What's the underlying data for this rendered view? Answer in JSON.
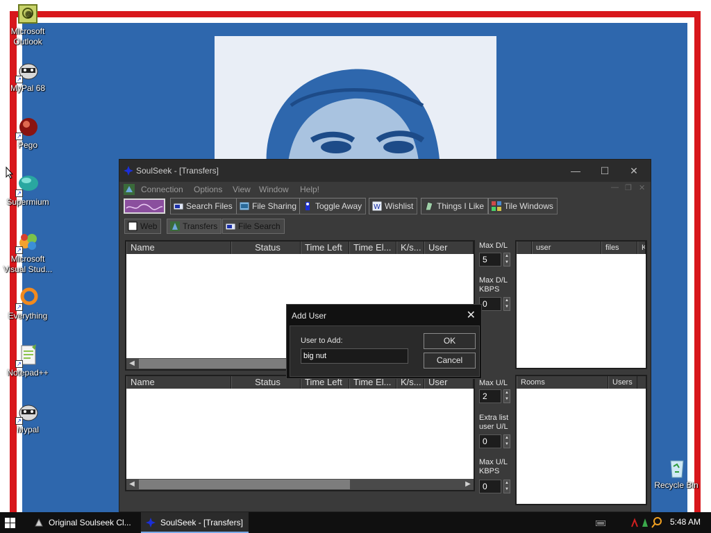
{
  "desktop": {
    "icons": [
      {
        "label": "Microsoft\nOutlook",
        "icon": "outlook-icon"
      },
      {
        "label": "MyPal 68",
        "icon": "raccoon-icon"
      },
      {
        "label": "Pego",
        "icon": "pego-icon"
      },
      {
        "label": "Supermium",
        "icon": "supermium-icon"
      },
      {
        "label": "Microsoft\nVisual Stud...",
        "icon": "visual-studio-icon"
      },
      {
        "label": "Everything",
        "icon": "everything-icon"
      },
      {
        "label": "Notepad++",
        "icon": "notepadpp-icon"
      },
      {
        "label": "Mypal",
        "icon": "raccoon-icon"
      }
    ],
    "recycle_bin": {
      "label": "Recycle Bin",
      "icon": "recycle-bin-icon"
    },
    "colors": {
      "frame_red": "#d8171c",
      "wall_blue": "#2e67ad",
      "poster_light": "#a9c3e0",
      "poster_dark": "#2e67ad"
    }
  },
  "window": {
    "title": "SoulSeek - [Transfers]",
    "controls": {
      "minimize": "—",
      "maximize": "☐",
      "close": "✕"
    },
    "menu": [
      "Connection",
      "Options",
      "View",
      "Window",
      "Help!"
    ],
    "toolbar": [
      {
        "label": "Search Files",
        "icon": "search-files-icon"
      },
      {
        "label": "File Sharing",
        "icon": "file-sharing-icon"
      },
      {
        "label": "Toggle Away",
        "icon": "toggle-away-icon"
      },
      {
        "label": "Wishlist",
        "icon": "wishlist-icon"
      },
      {
        "label": "Things I Like",
        "icon": "things-i-like-icon"
      },
      {
        "label": "Tile Windows",
        "icon": "tile-windows-icon"
      }
    ],
    "tabs": [
      {
        "label": "Web",
        "icon": "web-icon"
      },
      {
        "label": "Transfers",
        "icon": "transfers-icon"
      },
      {
        "label": "File Search",
        "icon": "file-search-icon"
      }
    ],
    "downloads": {
      "columns": [
        "Name",
        "Status",
        "Time Left",
        "Time El...",
        "K/s...",
        "User"
      ],
      "rows": []
    },
    "uploads": {
      "columns": [
        "Name",
        "Status",
        "Time Left",
        "Time El...",
        "K/s...",
        "User"
      ],
      "rows": []
    },
    "download_settings": {
      "max_dl_label": "Max D/L",
      "max_dl_value": "5",
      "max_dl_kbps_label": "Max D/L\nKBPS",
      "max_dl_kbps_value": "0"
    },
    "upload_settings": {
      "max_ul_label": "Max U/L",
      "max_ul_value": "2",
      "extra_list_label": "Extra list\nuser U/L",
      "extra_list_value": "0",
      "max_ul_kbps_label": "Max U/L\nKBPS",
      "max_ul_kbps_value": "0"
    },
    "users_list": {
      "columns": [
        "",
        "user",
        "files",
        "K"
      ]
    },
    "rooms_list": {
      "columns": [
        "Rooms",
        "Users"
      ]
    }
  },
  "dialog": {
    "title": "Add User",
    "close": "✕",
    "label": "User to Add:",
    "value": "big nut",
    "ok": "OK",
    "cancel": "Cancel"
  },
  "taskbar": {
    "tasks": [
      {
        "label": "Original Soulseek Cl...",
        "icon": "soulseek-client-icon"
      },
      {
        "label": "SoulSeek - [Transfers]",
        "icon": "soulseek-icon"
      }
    ],
    "clock": "5:48 AM"
  }
}
